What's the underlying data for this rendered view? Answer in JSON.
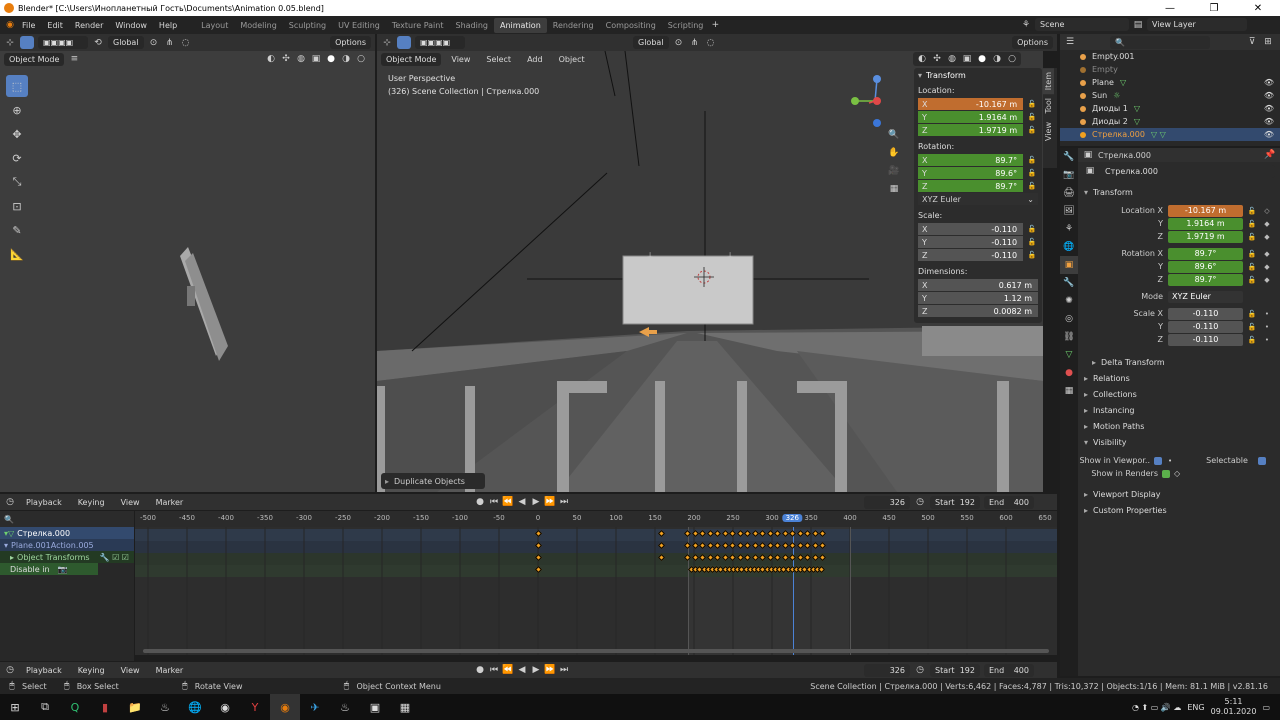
{
  "window": {
    "title": "Blender* [C:\\Users\\Инопланетный Гость\\Documents\\Animation 0.05.blend]",
    "controls": [
      "—",
      "❐",
      "✕"
    ]
  },
  "menu": [
    "File",
    "Edit",
    "Render",
    "Window",
    "Help"
  ],
  "workspaces": [
    "Layout",
    "Modeling",
    "Sculpting",
    "UV Editing",
    "Texture Paint",
    "Shading",
    "Animation",
    "Rendering",
    "Compositing",
    "Scripting"
  ],
  "active_workspace": "Animation",
  "scene": "Scene",
  "view_layer": "View Layer",
  "left_viewport": {
    "orientation": "Global",
    "options": "Options",
    "mode": "Object Mode"
  },
  "main_viewport": {
    "mode": "Object Mode",
    "menus": [
      "View",
      "Select",
      "Add",
      "Object"
    ],
    "orientation": "Global",
    "options": "Options",
    "perspective": "User Perspective",
    "collection": "(326) Scene Collection | Стрелка.000",
    "last_op": "Duplicate Objects",
    "side_tabs": [
      "Item",
      "Tool",
      "View"
    ]
  },
  "npanel": {
    "title": "Transform",
    "location_label": "Location:",
    "location": [
      {
        "axis": "X",
        "value": "-10.167 m"
      },
      {
        "axis": "Y",
        "value": "1.9164 m"
      },
      {
        "axis": "Z",
        "value": "1.9719 m"
      }
    ],
    "rotation_label": "Rotation:",
    "rotation": [
      {
        "axis": "X",
        "value": "89.7°"
      },
      {
        "axis": "Y",
        "value": "89.6°"
      },
      {
        "axis": "Z",
        "value": "89.7°"
      }
    ],
    "rotation_mode": "XYZ Euler",
    "scale_label": "Scale:",
    "scale": [
      {
        "axis": "X",
        "value": "-0.110"
      },
      {
        "axis": "Y",
        "value": "-0.110"
      },
      {
        "axis": "Z",
        "value": "-0.110"
      }
    ],
    "dimensions_label": "Dimensions:",
    "dimensions": [
      {
        "axis": "X",
        "value": "0.617 m"
      },
      {
        "axis": "Y",
        "value": "1.12 m"
      },
      {
        "axis": "Z",
        "value": "0.0082 m"
      }
    ]
  },
  "outliner": {
    "items": [
      {
        "name": "Empty.001"
      },
      {
        "name": "Empty"
      },
      {
        "name": "Plane"
      },
      {
        "name": "Sun"
      },
      {
        "name": "Диоды 1"
      },
      {
        "name": "Диоды 2"
      },
      {
        "name": "Стрелка.000"
      }
    ]
  },
  "properties": {
    "object_name": "Стрелка.000",
    "data_name": "Стрелка.000",
    "transform_title": "Transform",
    "loc_label": "Location X",
    "loc": [
      "-10.167 m",
      "1.9164 m",
      "1.9719 m"
    ],
    "rot_label": "Rotation X",
    "rot": [
      "89.7°",
      "89.6°",
      "89.7°"
    ],
    "mode_label": "Mode",
    "mode": "XYZ Euler",
    "scale_label": "Scale X",
    "scale": [
      "-0.110",
      "-0.110",
      "-0.110"
    ],
    "axis_y": "Y",
    "axis_z": "Z",
    "sections": [
      "Delta Transform",
      "Relations",
      "Collections",
      "Instancing",
      "Motion Paths",
      "Visibility"
    ],
    "show_viewport": "Show in Viewpor..",
    "selectable": "Selectable",
    "show_renders": "Show in Renders",
    "sections2": [
      "Viewport Display",
      "Custom Properties"
    ]
  },
  "timeline": {
    "playback": "Playback",
    "keying": "Keying",
    "view": "View",
    "marker": "Marker",
    "current_frame": "326",
    "start_label": "Start",
    "start": "192",
    "end_label": "End",
    "end": "400",
    "ruler": [
      "-500",
      "-450",
      "-400",
      "-350",
      "-300",
      "-250",
      "-200",
      "-150",
      "-100",
      "-50",
      "0",
      "50",
      "100",
      "150",
      "200",
      "250",
      "300",
      "326",
      "350",
      "400",
      "450",
      "500",
      "550",
      "600",
      "650"
    ],
    "channels": [
      "Стрелка.000",
      "Plane.001Action.005",
      "Object Transforms",
      "Disable in"
    ]
  },
  "status": {
    "select": "Select",
    "box_select": "Box Select",
    "rotate_view": "Rotate View",
    "context_menu": "Object Context Menu",
    "stats": "Scene Collection | Стрелка.000 | Verts:6,462 | Faces:4,787 | Tris:10,372 | Objects:1/16 | Mem: 81.1 MiB | v2.81.16"
  },
  "taskbar": {
    "lang": "ENG",
    "time": "5:11",
    "date": "09.01.2020"
  }
}
